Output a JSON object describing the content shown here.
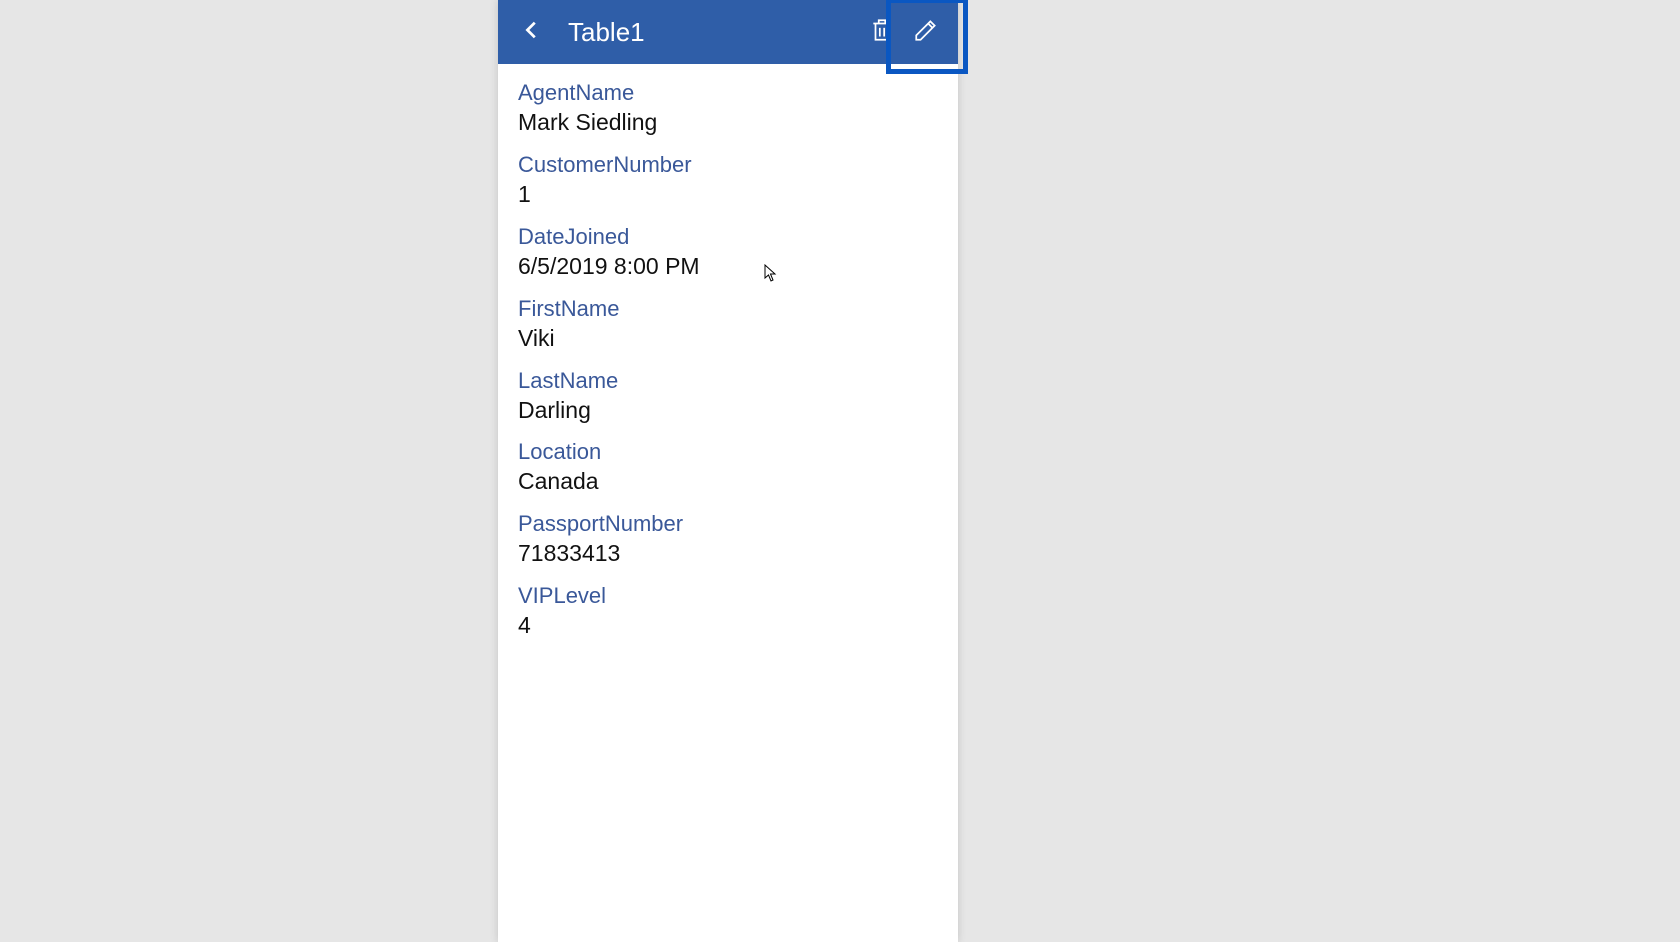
{
  "header": {
    "title": "Table1"
  },
  "fields": [
    {
      "label": "AgentName",
      "value": "Mark Siedling"
    },
    {
      "label": "CustomerNumber",
      "value": "1"
    },
    {
      "label": "DateJoined",
      "value": "6/5/2019 8:00 PM"
    },
    {
      "label": "FirstName",
      "value": "Viki"
    },
    {
      "label": "LastName",
      "value": "Darling"
    },
    {
      "label": "Location",
      "value": "Canada"
    },
    {
      "label": "PassportNumber",
      "value": "71833413"
    },
    {
      "label": "VIPLevel",
      "value": "4"
    }
  ],
  "icons": {
    "back": "back-icon",
    "delete": "trash-icon",
    "edit": "pencil-icon"
  }
}
